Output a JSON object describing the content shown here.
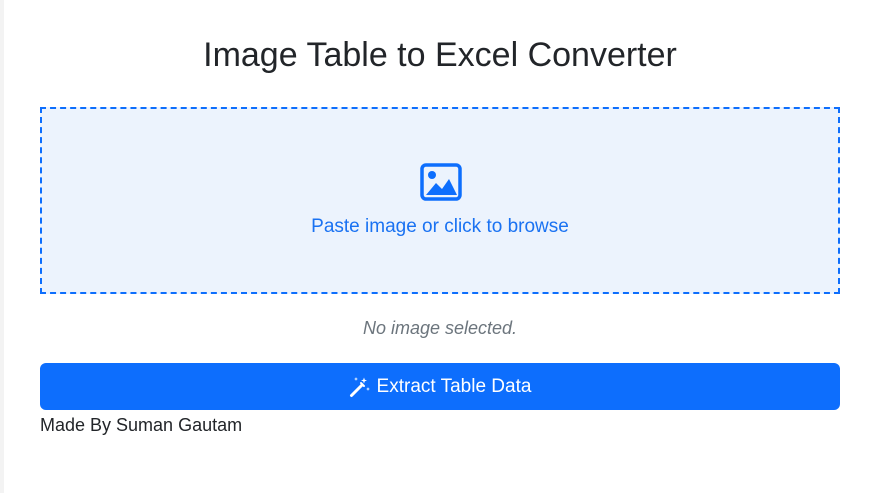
{
  "page": {
    "title": "Image Table to Excel Converter"
  },
  "dropzone": {
    "icon": "image-icon",
    "label": "Paste image or click to browse"
  },
  "status": {
    "text": "No image selected."
  },
  "extract_button": {
    "icon": "magic-wand-icon",
    "label": "Extract Table Data"
  },
  "footer": {
    "text": "Made By Suman Gautam"
  },
  "colors": {
    "primary": "#0d6efd",
    "dropzone_bg": "#ecf3fd",
    "status_text": "#6c757d",
    "heading_text": "#222529"
  }
}
